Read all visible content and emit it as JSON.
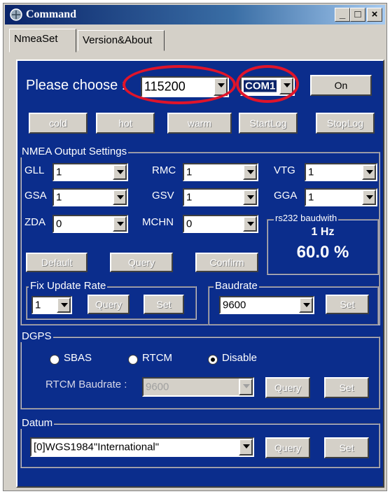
{
  "window": {
    "title": "Command",
    "minimize": "_",
    "maximize": "□",
    "close": "×"
  },
  "tabs": [
    {
      "label": "NmeaSet",
      "active": true
    },
    {
      "label": "Version&About",
      "active": false
    }
  ],
  "connection": {
    "label": "Please choose :",
    "baud": "115200",
    "port": "COM1",
    "on_label": "On"
  },
  "start_buttons": {
    "cold": "cold",
    "hot": "hot",
    "warm": "warm",
    "start_log": "StartLog",
    "stop_log": "StopLog"
  },
  "nmea": {
    "title": "NMEA Output Settings",
    "gll": {
      "label": "GLL",
      "value": "1"
    },
    "rmc": {
      "label": "RMC",
      "value": "1"
    },
    "vtg": {
      "label": "VTG",
      "value": "1"
    },
    "gsa": {
      "label": "GSA",
      "value": "1"
    },
    "gsv": {
      "label": "GSV",
      "value": "1"
    },
    "gga": {
      "label": "GGA",
      "value": "1"
    },
    "zda": {
      "label": "ZDA",
      "value": "0"
    },
    "mchn": {
      "label": "MCHN",
      "value": "0"
    },
    "default_label": "Default",
    "query_label": "Query",
    "confirm_label": "Confirm"
  },
  "bandwidth": {
    "title": "rs232 baudwith",
    "rate": "1 Hz",
    "percent": "60.0 %"
  },
  "fix_rate": {
    "title": "Fix Update Rate",
    "value": "1",
    "query_label": "Query",
    "set_label": "Set"
  },
  "baudrate": {
    "title": "Baudrate",
    "value": "9600",
    "set_label": "Set"
  },
  "dgps": {
    "title": "DGPS",
    "sbas": "SBAS",
    "rtcm": "RTCM",
    "disable": "Disable",
    "selected": "Disable",
    "rtcm_baud_label": "RTCM Baudrate :",
    "rtcm_baud": "9600",
    "query_label": "Query",
    "set_label": "Set"
  },
  "datum": {
    "title": "Datum",
    "value": "[0]WGS1984\"International\"",
    "query_label": "Query",
    "set_label": "Set"
  },
  "colors": {
    "panel_bg": "#0b2d8c",
    "highlight_ring": "#e0142a",
    "title_bar": "#0a246a",
    "selection": "#0a246a"
  }
}
